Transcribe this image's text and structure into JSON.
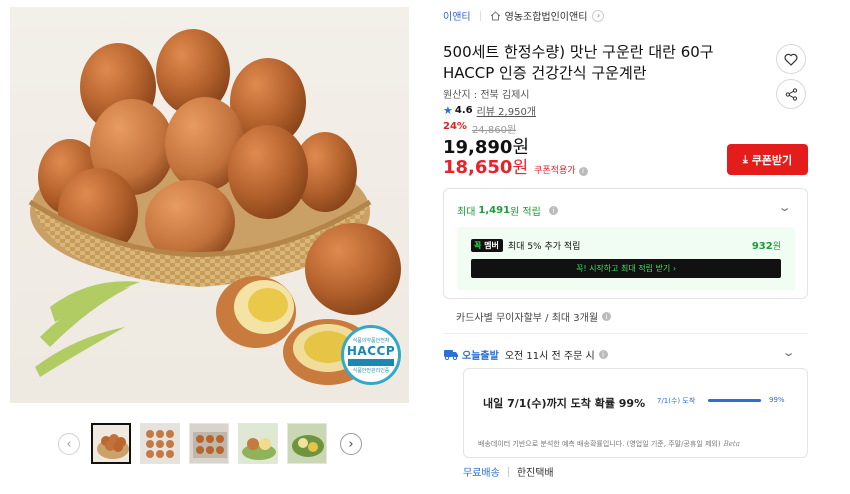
{
  "breadcrumb": {
    "brand": "이앤티",
    "seller": "영농조합법인이앤티"
  },
  "product": {
    "title": "500세트 한정수량) 맛난 구운란 대란 60구 HACCP 인증 건강간식 구운계란",
    "origin": "원산지 : 전북 김제시",
    "rating": "4.6",
    "reviews": "리뷰 2,950개"
  },
  "pricing": {
    "discount_pct": "24%",
    "original_price": "24,860원",
    "sale_price": "19,890",
    "sale_won": "원",
    "coupon_price": "18,650",
    "coupon_won": "원",
    "coupon_label": "쿠폰적용가"
  },
  "actions": {
    "coupon_button": "쿠폰받기"
  },
  "points": {
    "prefix": "최대",
    "amount": "1,491",
    "suffix": "원 적립",
    "member_badge_a": "꼭",
    "member_badge_b": "멤버",
    "member_text": "최대 5% 추가 적립",
    "member_amount": "932",
    "member_unit": "원",
    "member_cta": "꼭! 시작하고 최대 적립 받기  ›"
  },
  "installment": "카드사별 무이자할부 / 최대 3개월",
  "delivery": {
    "badge": "오늘출발",
    "cutoff": "오전 11시 전 주문 시",
    "main": "내일 7/1(수)까지 도착 확률 99%",
    "date_label": "7/1(수) 도착",
    "probability": 99,
    "probability_label": "99%",
    "note": "배송데이터 기반으로 분석한 예측 배송확률입니다. (영업일 기준, 주말/공휴일 제외)",
    "beta": "Beta",
    "shipping_fee": "무료배송",
    "carrier": "한진택배"
  },
  "image": {
    "haccp_top": "식품의약품안전처",
    "haccp_main": "HACCP",
    "haccp_bottom": "식품안전관리인증"
  },
  "colors": {
    "brand_blue": "#3162d6",
    "sale_red": "#e8222a",
    "point_green": "#1f9a3a"
  }
}
